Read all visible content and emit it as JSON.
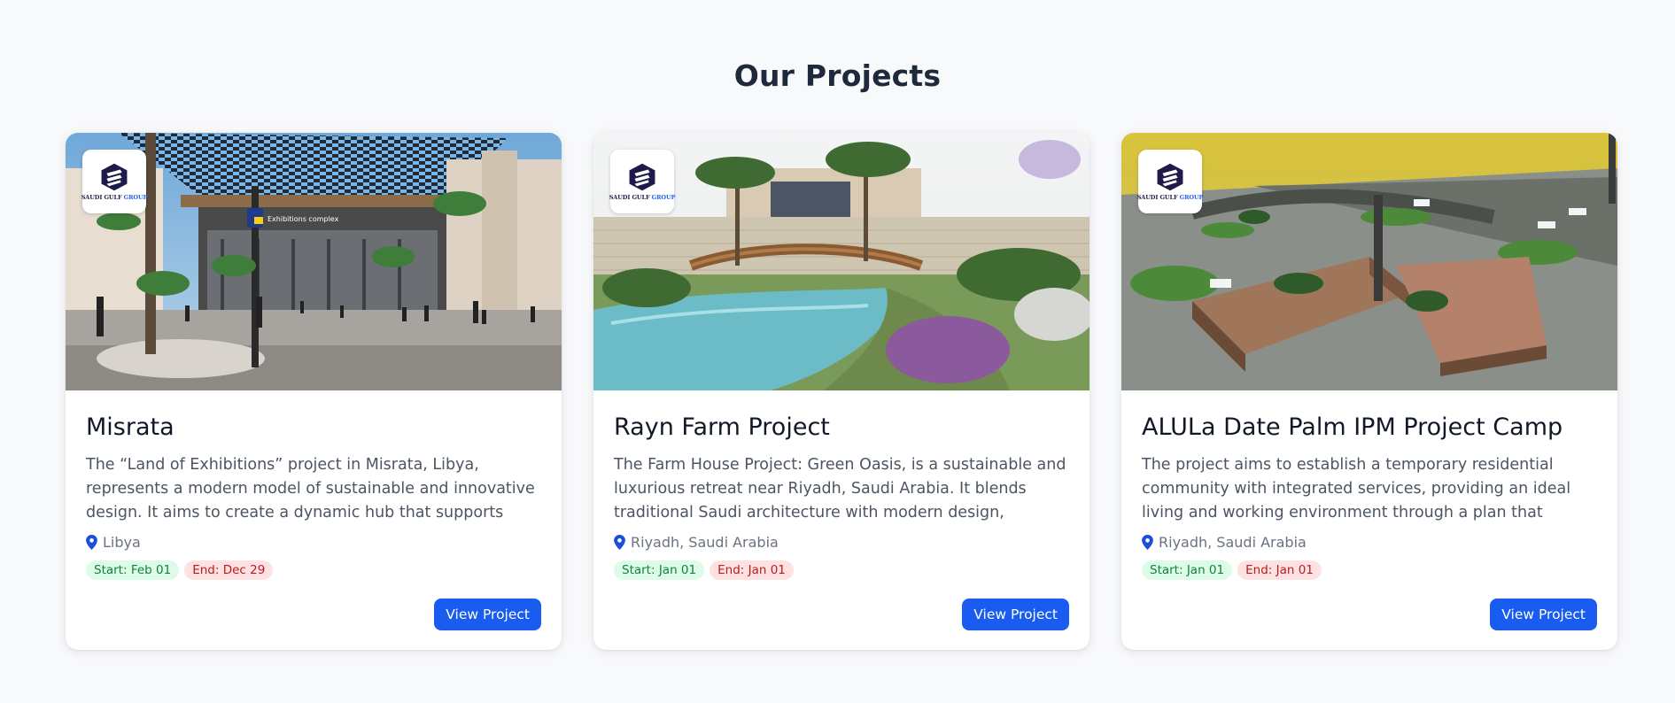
{
  "section": {
    "title": "Our Projects"
  },
  "logo": {
    "text_main": "SAUDI GULF ",
    "text_group": "GROUP"
  },
  "projects": [
    {
      "title": "Misrata",
      "description": "The “Land of Exhibitions” project in Misrata, Libya, represents a modern model of sustainable and innovative design. It aims to create a dynamic hub that supports economic, cultural, and...",
      "location": "Libya",
      "start": "Start: Feb 01",
      "end": "End: Dec 29",
      "button": "View Project",
      "image_text": "Exhibitions complex"
    },
    {
      "title": "Rayn Farm Project",
      "description": "The Farm House Project: Green Oasis, is a sustainable and luxurious retreat near Riyadh, Saudi Arabia. It blends traditional Saudi architecture with modern design, creating a serene...",
      "location": "Riyadh, Saudi Arabia",
      "start": "Start: Jan 01",
      "end": "End: Jan 01",
      "button": "View Project"
    },
    {
      "title": "ALULa Date Palm IPM Project Camp",
      "description": "The project aims to establish a temporary residential community with integrated services, providing an ideal living and working environment through a plan that balances...",
      "location": "Riyadh, Saudi Arabia",
      "start": "Start: Jan 01",
      "end": "End: Jan 01",
      "button": "View Project"
    }
  ],
  "colors": {
    "accent": "#1a5cf0",
    "start_badge_bg": "#dcfce7",
    "end_badge_bg": "#fee2e2",
    "pin": "#1d4ed8"
  }
}
